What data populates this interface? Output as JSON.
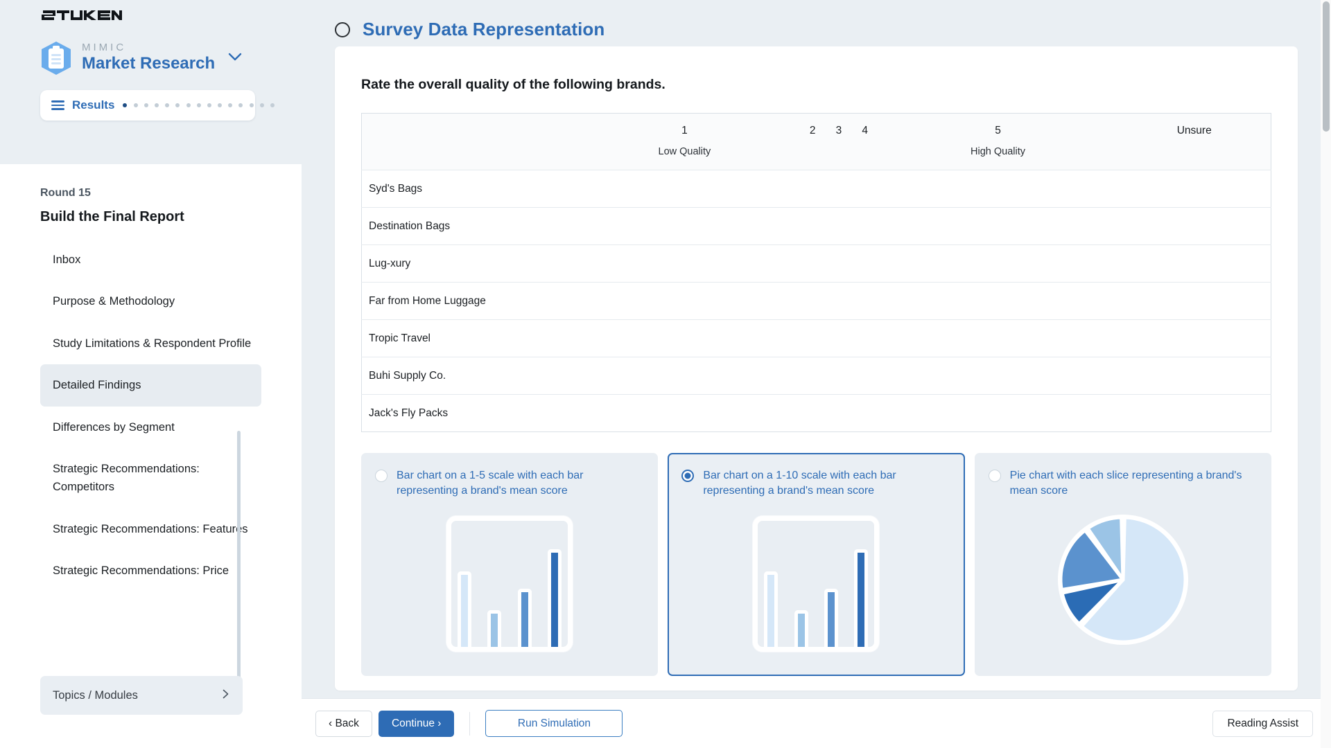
{
  "sidebar": {
    "brand_wordmark": "stukent",
    "product": {
      "eyebrow": "MIMIC",
      "name": "Market Research",
      "chevron_icon": "chevron-down-icon"
    },
    "results_nav": {
      "menu_icon": "hamburger-icon",
      "label": "Results",
      "total_dots": 15,
      "active_index": 0
    },
    "round_label": "Round 15",
    "round_title": "Build the Final Report",
    "items": [
      {
        "label": "Inbox",
        "active": false
      },
      {
        "label": "Purpose & Methodology",
        "active": false
      },
      {
        "label": "Study Limitations & Respondent Profile",
        "active": false
      },
      {
        "label": "Detailed Findings",
        "active": true
      },
      {
        "label": "Differences by Segment",
        "active": false
      },
      {
        "label": "Strategic Recommendations: Competitors",
        "active": false
      },
      {
        "label": "Strategic Recommendations: Features",
        "active": false
      },
      {
        "label": "Strategic Recommendations: Price",
        "active": false
      }
    ],
    "topics_modules": {
      "label": "Topics / Modules",
      "chevron_icon": "chevron-right-icon"
    }
  },
  "header": {
    "status_icon": "empty-circle-icon",
    "title": "Survey Data Representation"
  },
  "main": {
    "question_title": "Rate the overall quality of the following brands.",
    "table": {
      "columns": [
        {
          "num": "",
          "sub": ""
        },
        {
          "num": "1",
          "sub": "Low Quality"
        },
        {
          "num": "2",
          "sub": ""
        },
        {
          "num": "3",
          "sub": ""
        },
        {
          "num": "4",
          "sub": ""
        },
        {
          "num": "5",
          "sub": "High Quality"
        },
        {
          "num": "Unsure",
          "sub": ""
        }
      ],
      "rows": [
        "Syd's Bags",
        "Destination Bags",
        "Lug-xury",
        "Far from Home Luggage",
        "Tropic Travel",
        "Buhi Supply Co.",
        "Jack's Fly Packs"
      ]
    },
    "options": [
      {
        "label": "Bar chart on a 1-5 scale with each bar representing a brand's mean score",
        "selected": false,
        "thumb": "bar-chart-thumbnail"
      },
      {
        "label": "Bar chart on a 1-10 scale with each bar representing a brand's mean score",
        "selected": true,
        "thumb": "bar-chart-thumbnail"
      },
      {
        "label": "Pie chart with each slice representing a brand's mean score",
        "selected": false,
        "thumb": "pie-chart-thumbnail"
      }
    ]
  },
  "chart_data": [
    {
      "type": "bar",
      "title": "Bar chart thumbnail (option 1 and 2)",
      "categories": [
        "1",
        "2",
        "3",
        "4"
      ],
      "values": [
        62,
        30,
        48,
        80
      ],
      "colors": [
        "#d5e7f8",
        "#9bc4e6",
        "#5b92ce",
        "#2e6cb5"
      ],
      "xlabel": "",
      "ylabel": "",
      "ylim": [
        0,
        100
      ],
      "grid": false,
      "legend": "none"
    },
    {
      "type": "pie",
      "title": "Pie chart thumbnail (option 3)",
      "labels": [
        "slice-1",
        "slice-2",
        "slice-3",
        "slice-4"
      ],
      "values": [
        62,
        10,
        18,
        10
      ],
      "colors": [
        "#d5e7f8",
        "#2b6cb5",
        "#5b92ce",
        "#9bc4e6"
      ],
      "legend": "none"
    }
  ],
  "footer": {
    "back_label": "‹ Back",
    "continue_label": "Continue ›",
    "run_simulation_label": "Run Simulation",
    "reading_assist_label": "Reading Assist"
  },
  "theme": {
    "accent_blue": "#2e6cb5",
    "page_bg": "#eaeff3",
    "card_bg": "#ffffff",
    "active_nav_bg": "#e7ecf1"
  }
}
